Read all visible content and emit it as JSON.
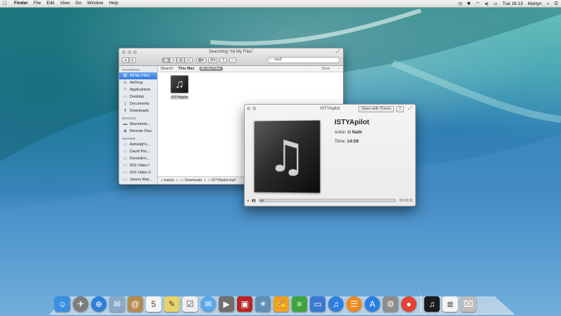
{
  "menubar": {
    "apple_glyph": "",
    "app_name": "Finder",
    "items": [
      "File",
      "Edit",
      "View",
      "Go",
      "Window",
      "Help"
    ],
    "clock": "Tue 16:13",
    "user": "Martyn"
  },
  "finder": {
    "title": "Searching “All My Files”",
    "search_value": "mp3",
    "sidebar": {
      "favorites_heading": "FAVORITES",
      "favorites": [
        {
          "label": "All My Files",
          "selected": true
        },
        {
          "label": "AirDrop"
        },
        {
          "label": "Applications"
        },
        {
          "label": "Desktop"
        },
        {
          "label": "Documents"
        },
        {
          "label": "Downloads"
        }
      ],
      "devices_heading": "DEVICES",
      "devices": [
        {
          "label": "Macintosh..."
        },
        {
          "label": "Remote Disc"
        }
      ],
      "shared_heading": "SHARED",
      "shared": [
        {
          "label": "Ashleigh's..."
        },
        {
          "label": "David Pric..."
        },
        {
          "label": "Dominik's..."
        },
        {
          "label": "IDG Video I"
        },
        {
          "label": "IDG Video II"
        },
        {
          "label": "James Wal..."
        }
      ]
    },
    "scope": {
      "search_label": "Search:",
      "this_mac": "This Mac",
      "all_my_files": "All My Files",
      "save": "Save",
      "minus": "−"
    },
    "file": {
      "name": "ISTYApilot"
    },
    "path": [
      "martyn",
      "Downloads",
      "ISTYApilot.mp3"
    ]
  },
  "quicklook": {
    "title": "ISTYApilot",
    "open_button": "Open with iTunes",
    "track_name": "ISTYApilot",
    "artist_label": "Artist:",
    "artist": "U Nath",
    "time_label": "Time:",
    "time": "14:59",
    "elapsed": "00:00:31",
    "progress_fraction": 0.035
  },
  "dock": {
    "items": [
      {
        "name": "finder",
        "glyph": "☺",
        "bg": "#3b8fe0"
      },
      {
        "name": "launchpad",
        "glyph": "✈",
        "bg": "#7d7d7d",
        "round": true
      },
      {
        "name": "safari",
        "glyph": "⊕",
        "bg": "#2f7fd6",
        "round": true
      },
      {
        "name": "mail",
        "glyph": "✉",
        "bg": "#8aa9c9"
      },
      {
        "name": "contacts",
        "glyph": "@",
        "bg": "#b58a52"
      },
      {
        "name": "calendar",
        "glyph": "5",
        "bg": "#f4f4f4"
      },
      {
        "name": "notes",
        "glyph": "✎",
        "bg": "#e8d36a"
      },
      {
        "name": "reminders",
        "glyph": "☑",
        "bg": "#efefef"
      },
      {
        "name": "messages",
        "glyph": "✉",
        "bg": "#5aa8ea",
        "round": true
      },
      {
        "name": "facetime",
        "glyph": "▶",
        "bg": "#6f6f6f"
      },
      {
        "name": "photo-booth",
        "glyph": "▣",
        "bg": "#b82424"
      },
      {
        "name": "iphoto",
        "glyph": "☀",
        "bg": "#5f8fb7"
      },
      {
        "name": "pages",
        "glyph": "✍",
        "bg": "#f0a020"
      },
      {
        "name": "numbers",
        "glyph": "≡",
        "bg": "#3fa33f"
      },
      {
        "name": "keynote",
        "glyph": "▭",
        "bg": "#3a78d1"
      },
      {
        "name": "itunes",
        "glyph": "♫",
        "bg": "#2f7fe0",
        "round": true
      },
      {
        "name": "ibooks",
        "glyph": "☰",
        "bg": "#f08a1f",
        "round": true
      },
      {
        "name": "app-store",
        "glyph": "A",
        "bg": "#2c7fe2",
        "round": true
      },
      {
        "name": "system-preferences",
        "glyph": "⚙",
        "bg": "#8d8d8d"
      },
      {
        "name": "chrome",
        "glyph": "●",
        "bg": "#e34234",
        "round": true
      },
      {
        "name": "itunes-file",
        "glyph": "♫",
        "bg": "#1c1c1c",
        "divider_before": true
      },
      {
        "name": "document",
        "glyph": "≣",
        "bg": "#f4f4f4"
      },
      {
        "name": "trash",
        "glyph": "⌧",
        "bg": "#bdbdbd"
      }
    ]
  }
}
